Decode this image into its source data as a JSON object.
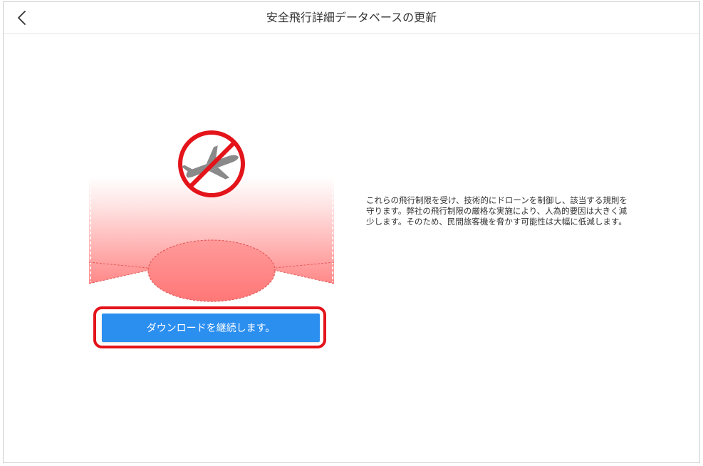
{
  "header": {
    "title": "安全飛行詳細データベースの更新",
    "back_icon": "chevron-left-icon"
  },
  "illustration": {
    "icon": "no-airplane-icon",
    "zone_color": "#ff6b6b",
    "prohibition_color": "#e3141a"
  },
  "actions": {
    "continue_label": "ダウンロードを継続します。",
    "button_color": "#2b8ff0",
    "highlight_color": "#e3141a"
  },
  "description": {
    "text": "これらの飛行制限を受け、技術的にドローンを制御し、該当する規則を守ります。弊社の飛行制限の厳格な実施により、人為的要因は大きく減少します。そのため、民間旅客機を脅かす可能性は大幅に低減します。"
  }
}
